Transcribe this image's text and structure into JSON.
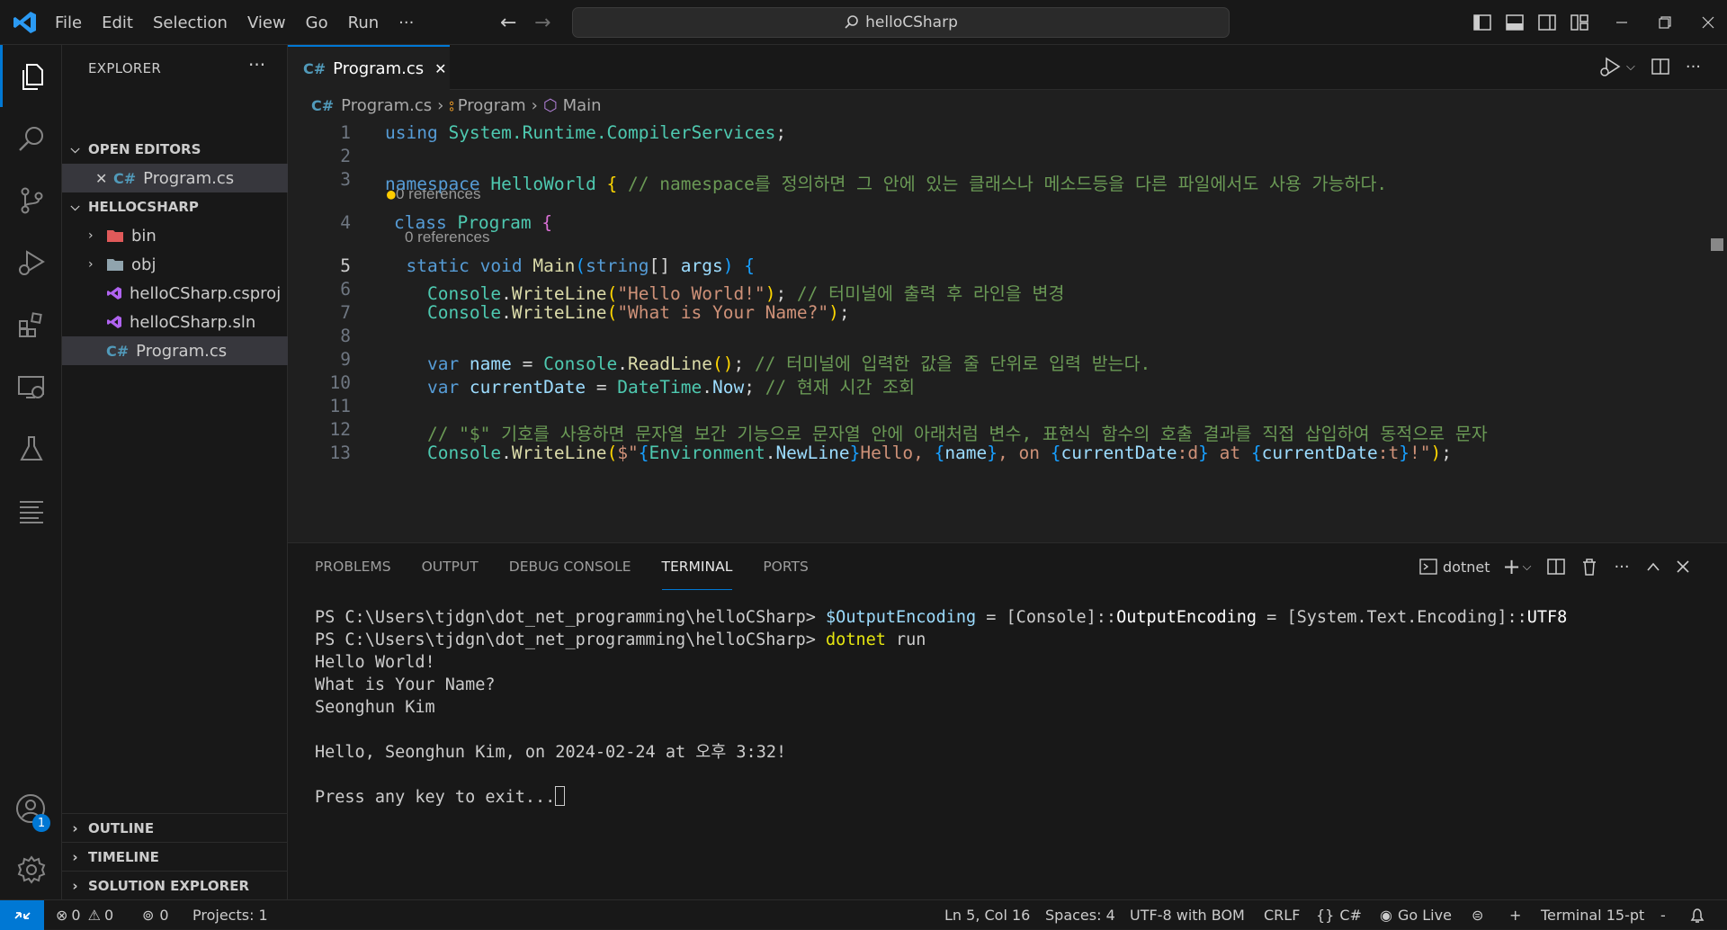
{
  "menu": [
    "File",
    "Edit",
    "Selection",
    "View",
    "Go",
    "Run",
    "···"
  ],
  "search": {
    "text": "helloCSharp"
  },
  "sidebar": {
    "title": "EXPLORER",
    "open_editors": "OPEN EDITORS",
    "open_file": "Program.cs",
    "workspace": "HELLOCSHARP",
    "items": [
      {
        "label": "bin",
        "kind": "folder"
      },
      {
        "label": "obj",
        "kind": "folder"
      },
      {
        "label": "helloCSharp.csproj",
        "kind": "vs"
      },
      {
        "label": "helloCSharp.sln",
        "kind": "vs"
      },
      {
        "label": "Program.cs",
        "kind": "cs"
      }
    ],
    "bottom": [
      "OUTLINE",
      "TIMELINE",
      "SOLUTION EXPLORER"
    ]
  },
  "account_badge": "1",
  "tab": {
    "icon": "C#",
    "label": "Program.cs"
  },
  "breadcrumb": {
    "file": "Program.cs",
    "cls": "Program",
    "method": "Main"
  },
  "lines": [
    {
      "n": "1",
      "tokens": [
        [
          "k",
          "using "
        ],
        [
          "t",
          "System.Runtime.CompilerServices"
        ],
        [
          "",
          "; "
        ]
      ]
    },
    {
      "n": "2",
      "tokens": []
    },
    {
      "n": "3",
      "tokens": [
        [
          "k",
          "namespace "
        ],
        [
          "t",
          "HelloWorld "
        ],
        [
          "p",
          "{ "
        ],
        [
          "c",
          "// namespace를 정의하면 그 안에 있는 클래스나 메소드등을 다른 파일에서도 사용 가능하다."
        ]
      ]
    },
    {
      "n": "4",
      "tokens": [
        [
          "k",
          "class "
        ],
        [
          "t",
          "Program "
        ],
        [
          "pp",
          "{"
        ]
      ]
    },
    {
      "n": "5",
      "tokens": [
        [
          "k",
          "  static void "
        ],
        [
          "f",
          "Main"
        ],
        [
          "pb",
          "("
        ],
        [
          "k",
          "string"
        ],
        [
          "",
          "[] "
        ],
        [
          "v",
          "args"
        ],
        [
          "pb",
          ") {"
        ]
      ]
    },
    {
      "n": "6",
      "tokens": [
        [
          "t",
          "    Console"
        ],
        [
          "",
          "."
        ],
        [
          "f",
          "WriteLine"
        ],
        [
          "p",
          "("
        ],
        [
          "s",
          "\"Hello World!\""
        ],
        [
          "p",
          ")"
        ],
        [
          "",
          "; "
        ],
        [
          "c",
          "// 터미널에 출력 후 라인을 변경"
        ]
      ]
    },
    {
      "n": "7",
      "tokens": [
        [
          "t",
          "    Console"
        ],
        [
          "",
          "."
        ],
        [
          "f",
          "WriteLine"
        ],
        [
          "p",
          "("
        ],
        [
          "s",
          "\"What is Your Name?\""
        ],
        [
          "p",
          ")"
        ],
        [
          "",
          ";"
        ]
      ]
    },
    {
      "n": "8",
      "tokens": []
    },
    {
      "n": "9",
      "tokens": [
        [
          "k",
          "    var "
        ],
        [
          "v",
          "name "
        ],
        [
          "",
          "= "
        ],
        [
          "t",
          "Console"
        ],
        [
          "",
          "."
        ],
        [
          "f",
          "ReadLine"
        ],
        [
          "p",
          "()"
        ],
        [
          "",
          "; "
        ],
        [
          "c",
          "// 터미널에 입력한 값을 줄 단위로 입력 받는다."
        ]
      ]
    },
    {
      "n": "10",
      "tokens": [
        [
          "k",
          "    var "
        ],
        [
          "v",
          "currentDate "
        ],
        [
          "",
          "= "
        ],
        [
          "t",
          "DateTime"
        ],
        [
          "",
          "."
        ],
        [
          "v",
          "Now"
        ],
        [
          "",
          "; "
        ],
        [
          "c",
          "// 현재 시간 조회"
        ]
      ]
    },
    {
      "n": "11",
      "tokens": []
    },
    {
      "n": "12",
      "tokens": [
        [
          "c",
          "    // \"$\" 기호를 사용하면 문자열 보간 기능으로 문자열 안에 아래처럼 변수, 표현식 함수의 호출 결과를 직접 삽입하여 동적으로 문자"
        ]
      ]
    },
    {
      "n": "13",
      "tokens": [
        [
          "t",
          "    Console"
        ],
        [
          "",
          "."
        ],
        [
          "f",
          "WriteLine"
        ],
        [
          "p",
          "("
        ],
        [
          "s",
          "$\""
        ],
        [
          "pb",
          "{"
        ],
        [
          "t",
          "Environment"
        ],
        [
          "",
          "."
        ],
        [
          "v",
          "NewLine"
        ],
        [
          "pb",
          "}"
        ],
        [
          "s",
          "Hello, "
        ],
        [
          "pb",
          "{"
        ],
        [
          "v",
          "name"
        ],
        [
          "pb",
          "}"
        ],
        [
          "s",
          ", on "
        ],
        [
          "pb",
          "{"
        ],
        [
          "v",
          "currentDate"
        ],
        [
          "s",
          ":d"
        ],
        [
          "pb",
          "}"
        ],
        [
          "s",
          " at "
        ],
        [
          "pb",
          "{"
        ],
        [
          "v",
          "currentDate"
        ],
        [
          "s",
          ":t"
        ],
        [
          "pb",
          "}"
        ],
        [
          "s",
          "!\""
        ],
        [
          "p",
          ")"
        ],
        [
          "",
          ";"
        ]
      ]
    }
  ],
  "codelens": "0 references",
  "panel": {
    "tabs": [
      "PROBLEMS",
      "OUTPUT",
      "DEBUG CONSOLE",
      "TERMINAL",
      "PORTS"
    ],
    "shell": "dotnet",
    "terminal": [
      [
        [
          "",
          "PS C:\\Users\\tjdgn\\dot_net_programming\\helloCSharp> "
        ],
        [
          "v2",
          "$OutputEncoding"
        ],
        [
          "g",
          " = "
        ],
        [
          "",
          "[Console]::"
        ],
        [
          "w",
          "OutputEncoding"
        ],
        [
          "g",
          " = "
        ],
        [
          "",
          "[System.Text.Encoding]::"
        ],
        [
          "w",
          "UTF8"
        ]
      ],
      [
        [
          "",
          "PS C:\\Users\\tjdgn\\dot_net_programming\\helloCSharp> "
        ],
        [
          "y",
          "dotnet"
        ],
        [
          "",
          " run"
        ]
      ],
      [
        [
          "",
          "Hello World!"
        ]
      ],
      [
        [
          "",
          "What is Your Name?"
        ]
      ],
      [
        [
          "",
          "Seonghun Kim"
        ]
      ],
      [
        [
          "",
          ""
        ]
      ],
      [
        [
          "",
          "Hello, Seonghun Kim, on 2024-02-24 at 오후 3:32!"
        ]
      ],
      [
        [
          "",
          ""
        ]
      ],
      [
        [
          "",
          "Press any key to exit..."
        ]
      ]
    ]
  },
  "status": {
    "errors": "0",
    "warnings": "0",
    "ports": "0",
    "projects": "Projects: 1",
    "position": "Ln 5, Col 16",
    "spaces": "Spaces: 4",
    "encoding": "UTF-8 with BOM",
    "eol": "CRLF",
    "lang": "C#",
    "golive": "Go Live",
    "term": "Terminal 15-pt"
  },
  "colors": {
    "accent": "#0078d4",
    "bg": "#1f1f1f",
    "chrome": "#181818"
  }
}
